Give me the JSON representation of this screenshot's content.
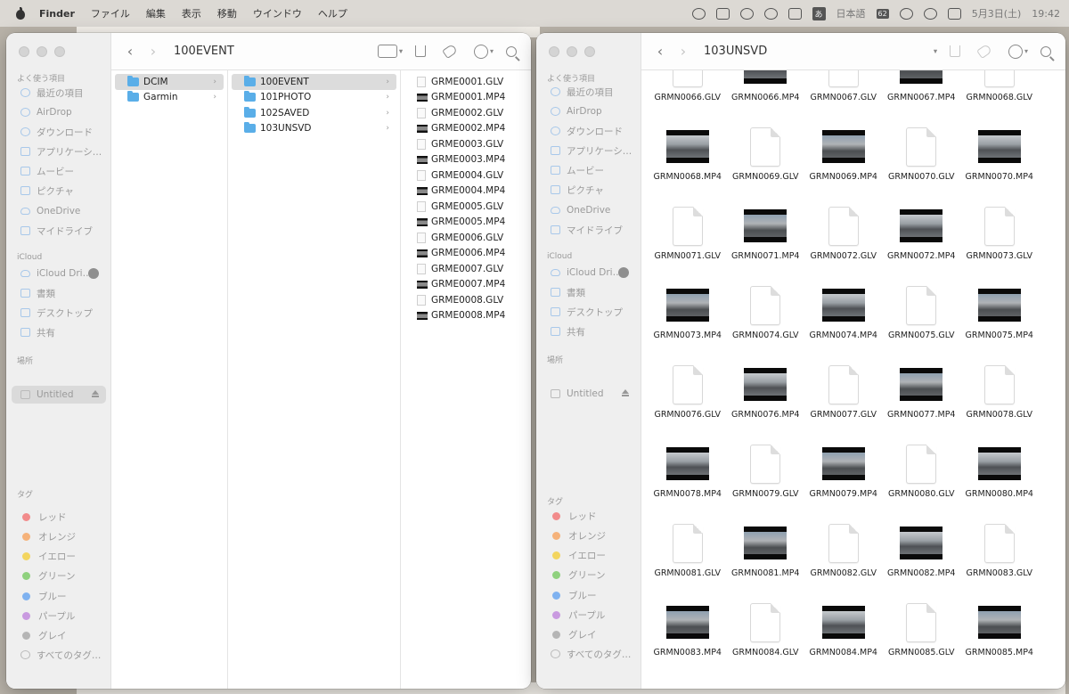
{
  "menubar": {
    "app": "Finder",
    "items": [
      "ファイル",
      "編集",
      "表示",
      "移動",
      "ウインドウ",
      "ヘルプ"
    ],
    "ime": "あ",
    "ime_label": "日本語",
    "battery_badge": "62",
    "date": "5月3日(土)",
    "time": "19:42"
  },
  "sidebar": {
    "favorites_label": "よく使う項目",
    "favorites": [
      "最近の項目",
      "AirDrop",
      "ダウンロード",
      "アプリケーシ…",
      "ムービー",
      "ピクチャ",
      "OneDrive",
      "マイドライブ"
    ],
    "icloud_label": "iCloud",
    "icloud": [
      "iCloud Dri…",
      "書類",
      "デスクトップ",
      "共有"
    ],
    "locations_label": "場所",
    "locations": [
      "Untitled"
    ],
    "tags_label": "タグ",
    "tags": [
      {
        "name": "レッド",
        "color": "#f28b8b"
      },
      {
        "name": "オレンジ",
        "color": "#f5b27a"
      },
      {
        "name": "イエロー",
        "color": "#f3d55f"
      },
      {
        "name": "グリーン",
        "color": "#8fd17e"
      },
      {
        "name": "ブルー",
        "color": "#7fb2f0"
      },
      {
        "name": "パープル",
        "color": "#c99ae0"
      },
      {
        "name": "グレイ",
        "color": "#b5b5b5"
      }
    ],
    "all_tags": "すべてのタグ…"
  },
  "left_window": {
    "title": "100EVENT",
    "col1": [
      "DCIM",
      "Garmin"
    ],
    "col2": [
      "100EVENT",
      "101PHOTO",
      "102SAVED",
      "103UNSVD"
    ],
    "col3": [
      "GRME0001.GLV",
      "GRME0001.MP4",
      "GRME0002.GLV",
      "GRME0002.MP4",
      "GRME0003.GLV",
      "GRME0003.MP4",
      "GRME0004.GLV",
      "GRME0004.MP4",
      "GRME0005.GLV",
      "GRME0005.MP4",
      "GRME0006.GLV",
      "GRME0006.MP4",
      "GRME0007.GLV",
      "GRME0007.MP4",
      "GRME0008.GLV",
      "GRME0008.MP4"
    ]
  },
  "right_window": {
    "title": "103UNSVD",
    "files": [
      "GRMN0066.GLV",
      "GRMN0066.MP4",
      "GRMN0067.GLV",
      "GRMN0067.MP4",
      "GRMN0068.GLV",
      "GRMN0068.MP4",
      "GRMN0069.GLV",
      "GRMN0069.MP4",
      "GRMN0070.GLV",
      "GRMN0070.MP4",
      "GRMN0071.GLV",
      "GRMN0071.MP4",
      "GRMN0072.GLV",
      "GRMN0072.MP4",
      "GRMN0073.GLV",
      "GRMN0073.MP4",
      "GRMN0074.GLV",
      "GRMN0074.MP4",
      "GRMN0075.GLV",
      "GRMN0075.MP4",
      "GRMN0076.GLV",
      "GRMN0076.MP4",
      "GRMN0077.GLV",
      "GRMN0077.MP4",
      "GRMN0078.GLV",
      "GRMN0078.MP4",
      "GRMN0079.GLV",
      "GRMN0079.MP4",
      "GRMN0080.GLV",
      "GRMN0080.MP4",
      "GRMN0081.GLV",
      "GRMN0081.MP4",
      "GRMN0082.GLV",
      "GRMN0082.MP4",
      "GRMN0083.GLV",
      "GRMN0083.MP4",
      "GRMN0084.GLV",
      "GRMN0084.MP4",
      "GRMN0085.GLV",
      "GRMN0085.MP4"
    ]
  }
}
